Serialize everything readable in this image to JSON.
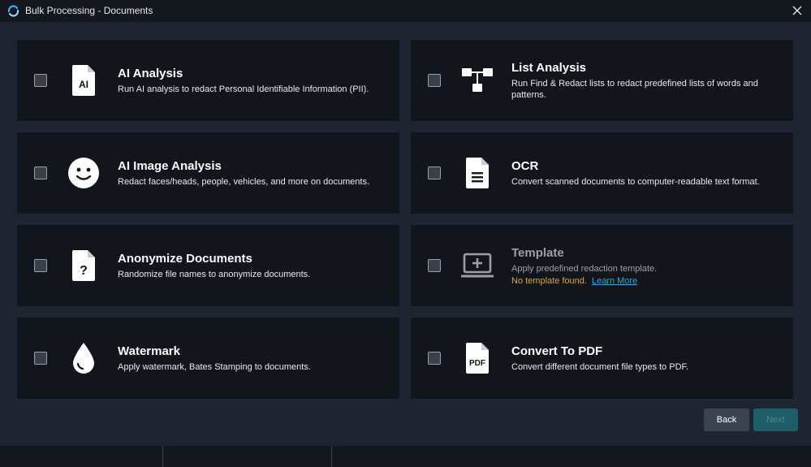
{
  "window": {
    "title": "Bulk Processing - Documents"
  },
  "colors": {
    "card_bg": "#12151b",
    "page_bg": "#1f2530",
    "warning": "#d9a24a",
    "link": "#3aa3d8",
    "next_bg": "#1f5c66"
  },
  "cards": [
    {
      "icon": "ai-document-icon",
      "title": "AI Analysis",
      "desc": "Run AI analysis to redact Personal Identifiable Information (PII).",
      "icon_label": "AI"
    },
    {
      "icon": "flowchart-icon",
      "title": "List Analysis",
      "desc": "Run Find & Redact lists to redact predefined lists of words and patterns."
    },
    {
      "icon": "smiley-face-icon",
      "title": "AI Image Analysis",
      "desc": "Redact faces/heads, people, vehicles, and more on documents."
    },
    {
      "icon": "text-document-icon",
      "title": "OCR",
      "desc": "Convert scanned documents to computer-readable text format."
    },
    {
      "icon": "question-document-icon",
      "title": "Anonymize Documents",
      "desc": "Randomize file names to anonymize documents.",
      "icon_label": "?"
    },
    {
      "icon": "laptop-add-icon",
      "title": "Template",
      "desc": "Apply predefined redaction template.",
      "warning": "No template found.",
      "link": "Learn More"
    },
    {
      "icon": "water-drop-icon",
      "title": "Watermark",
      "desc": "Apply watermark, Bates Stamping to documents."
    },
    {
      "icon": "pdf-document-icon",
      "title": "Convert To PDF",
      "desc": "Convert different document file types to PDF.",
      "icon_label": "PDF"
    }
  ],
  "buttons": {
    "back": "Back",
    "next": "Next"
  }
}
